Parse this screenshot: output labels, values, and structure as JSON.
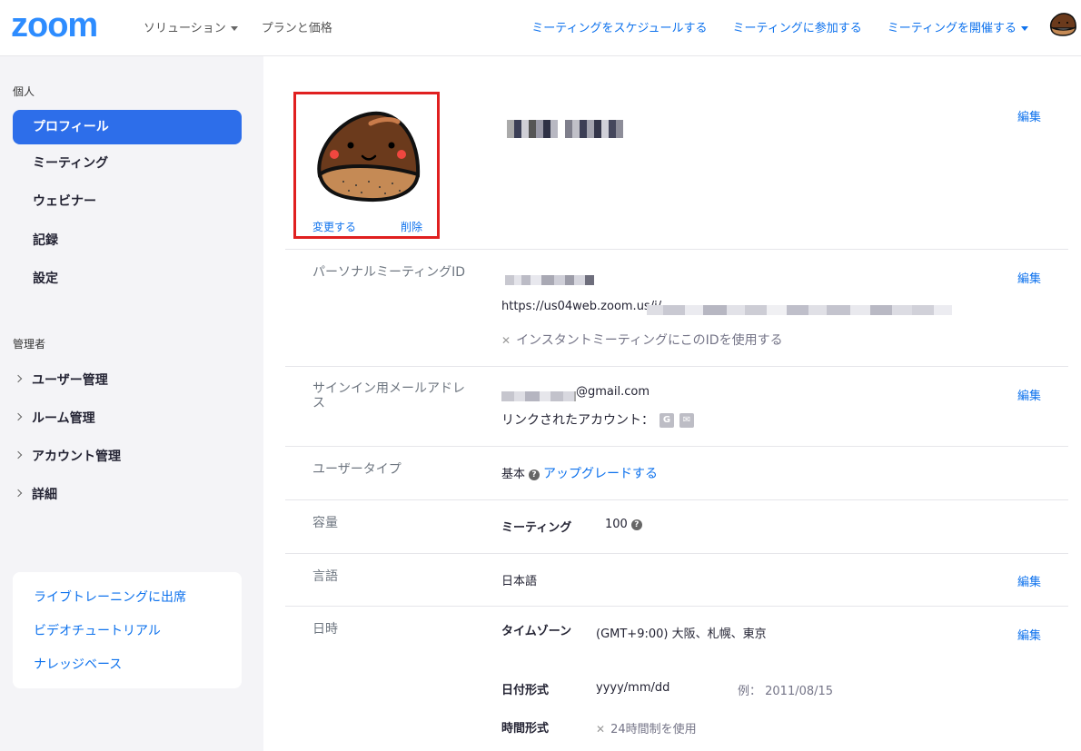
{
  "header": {
    "logo": "zoom",
    "nav_left": [
      "ソリューション",
      "プランと価格"
    ],
    "nav_right": [
      "ミーティングをスケジュールする",
      "ミーティングに参加する",
      "ミーティングを開催する"
    ]
  },
  "sidebar": {
    "personal_label": "個人",
    "personal_items": [
      "プロフィール",
      "ミーティング",
      "ウェビナー",
      "記録",
      "設定"
    ],
    "admin_label": "管理者",
    "admin_items": [
      "ユーザー管理",
      "ルーム管理",
      "アカウント管理",
      "詳細"
    ],
    "help_links": [
      "ライブトレーニングに出席",
      "ビデオチュートリアル",
      "ナレッジベース"
    ]
  },
  "profile": {
    "photo_change": "変更する",
    "photo_delete": "削除",
    "edit_label": "編集"
  },
  "rows": {
    "pmi": {
      "label": "パーソナルミーティングID",
      "url_prefix": "https://us04web.zoom.us/j/",
      "instant_option": "インスタントミーティングにこのIDを使用する"
    },
    "email": {
      "label": "サインイン用メールアドレス",
      "domain": "@gmail.com",
      "linked_accounts": "リンクされたアカウント："
    },
    "user_type": {
      "label": "ユーザータイプ",
      "value": "基本",
      "upgrade": "アップグレードする"
    },
    "capacity": {
      "label": "容量",
      "meeting_label": "ミーティング",
      "meeting_value": "100"
    },
    "language": {
      "label": "言語",
      "value": "日本語"
    },
    "datetime": {
      "label": "日時",
      "timezone_label": "タイムゾーン",
      "timezone_value": "(GMT+9:00) 大阪、札幌、東京",
      "date_format_label": "日付形式",
      "date_format_value": "yyyy/mm/dd",
      "date_example": "例：  2011/08/15",
      "time_format_label": "時間形式",
      "time_format_value": "24時間制を使用"
    }
  }
}
